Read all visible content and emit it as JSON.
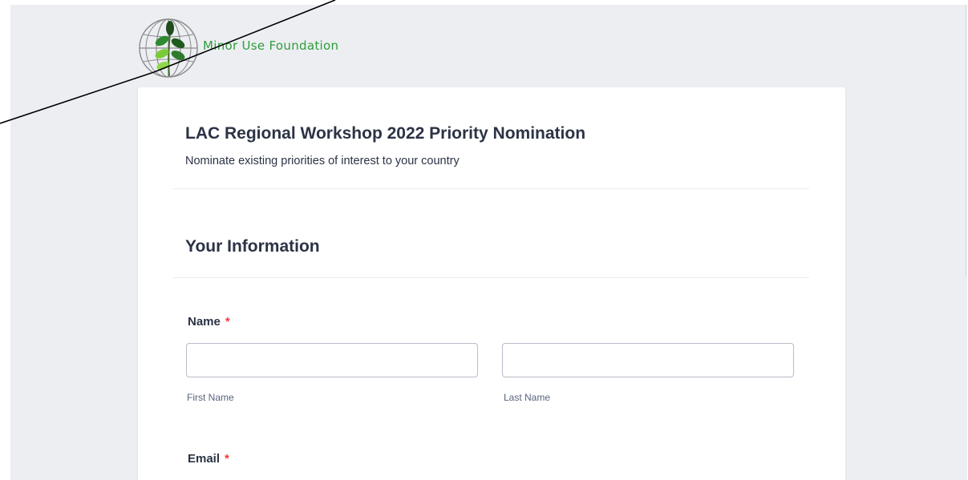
{
  "brand": {
    "logo_icon": "globe-leaf-icon",
    "name": "Minor Use Foundation",
    "accent_color": "#2e9e3a"
  },
  "form": {
    "title": "LAC Regional Workshop 2022 Priority Nomination",
    "subtitle": "Nominate existing priorities of interest to your country",
    "section_title": "Your Information",
    "required_marker": "*",
    "name_field": {
      "label": "Name",
      "first_name": {
        "value": "",
        "placeholder": "",
        "sublabel": "First Name"
      },
      "last_name": {
        "value": "",
        "placeholder": "",
        "sublabel": "Last Name"
      }
    },
    "email_field": {
      "label": "Email"
    }
  },
  "colors": {
    "page_background": "#eceef2",
    "text": "#2c3345",
    "required": "#f23a3c",
    "input_border": "#b8bdc9"
  }
}
